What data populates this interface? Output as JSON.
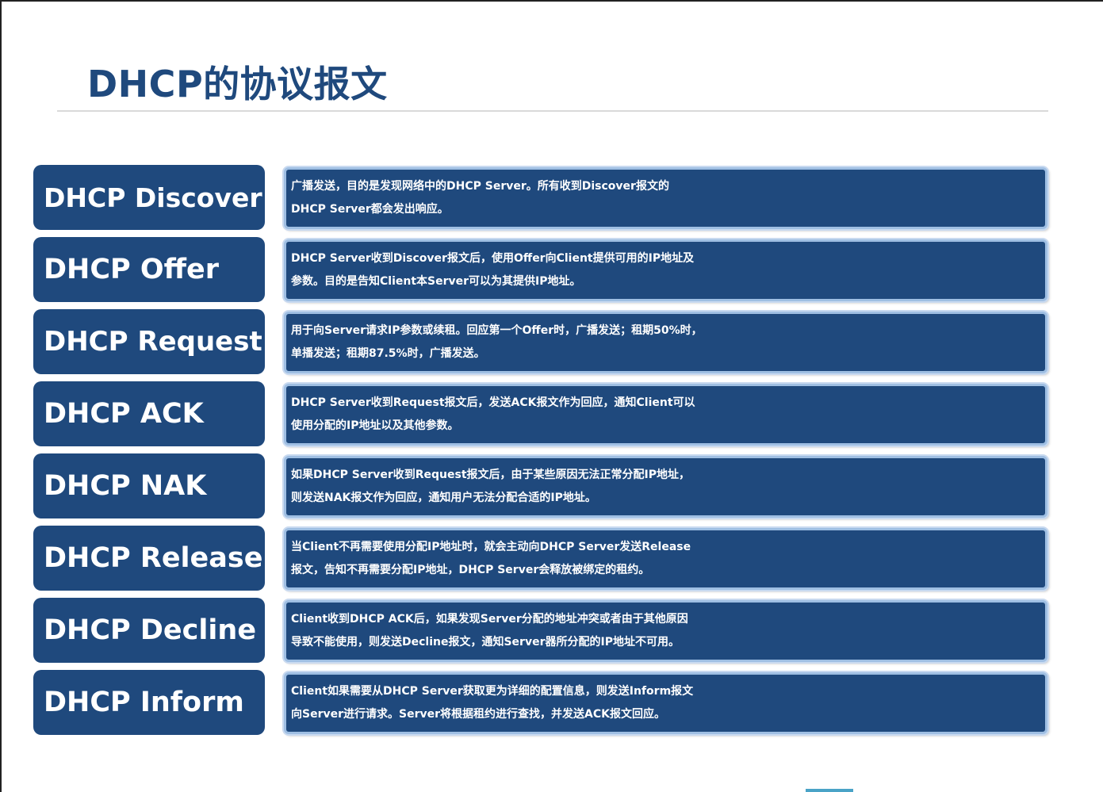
{
  "title": "DHCP的协议报文",
  "rows": [
    {
      "name": "DHCP Discover",
      "desc": [
        "广播发送，目的是发现网络中的DHCP Server。所有收到Discover报文的",
        "DHCP Server都会发出响应。"
      ]
    },
    {
      "name": "DHCP Offer",
      "desc": [
        "DHCP Server收到Discover报文后，使用Offer向Client提供可用的IP地址及",
        "参数。目的是告知Client本Server可以为其提供IP地址。"
      ]
    },
    {
      "name": "DHCP Request",
      "desc": [
        "用于向Server请求IP参数或续租。回应第一个Offer时，广播发送；租期50%时，",
        "单播发送；租期87.5%时，广播发送。"
      ]
    },
    {
      "name": "DHCP ACK",
      "desc": [
        "DHCP Server收到Request报文后，发送ACK报文作为回应，通知Client可以",
        "使用分配的IP地址以及其他参数。"
      ]
    },
    {
      "name": "DHCP NAK",
      "desc": [
        "如果DHCP Server收到Request报文后，由于某些原因无法正常分配IP地址，",
        "则发送NAK报文作为回应，通知用户无法分配合适的IP地址。"
      ]
    },
    {
      "name": "DHCP Release",
      "desc": [
        "当Client不再需要使用分配IP地址时，就会主动向DHCP Server发送Release",
        "报文，告知不再需要分配IP地址，DHCP Server会释放被绑定的租约。"
      ]
    },
    {
      "name": "DHCP Decline",
      "desc": [
        "Client收到DHCP ACK后，如果发现Server分配的地址冲突或者由于其他原因",
        "导致不能使用，则发送Decline报文，通知Server器所分配的IP地址不可用。"
      ]
    },
    {
      "name": "DHCP Inform",
      "desc": [
        "Client如果需要从DHCP Server获取更为详细的配置信息，则发送Inform报文",
        "向Server进行请求。Server将根据租约进行查找，并发送ACK报文回应。"
      ]
    }
  ],
  "colors": {
    "box": "#1f497d",
    "title": "#1f497d",
    "border": "#9fbfe3"
  }
}
